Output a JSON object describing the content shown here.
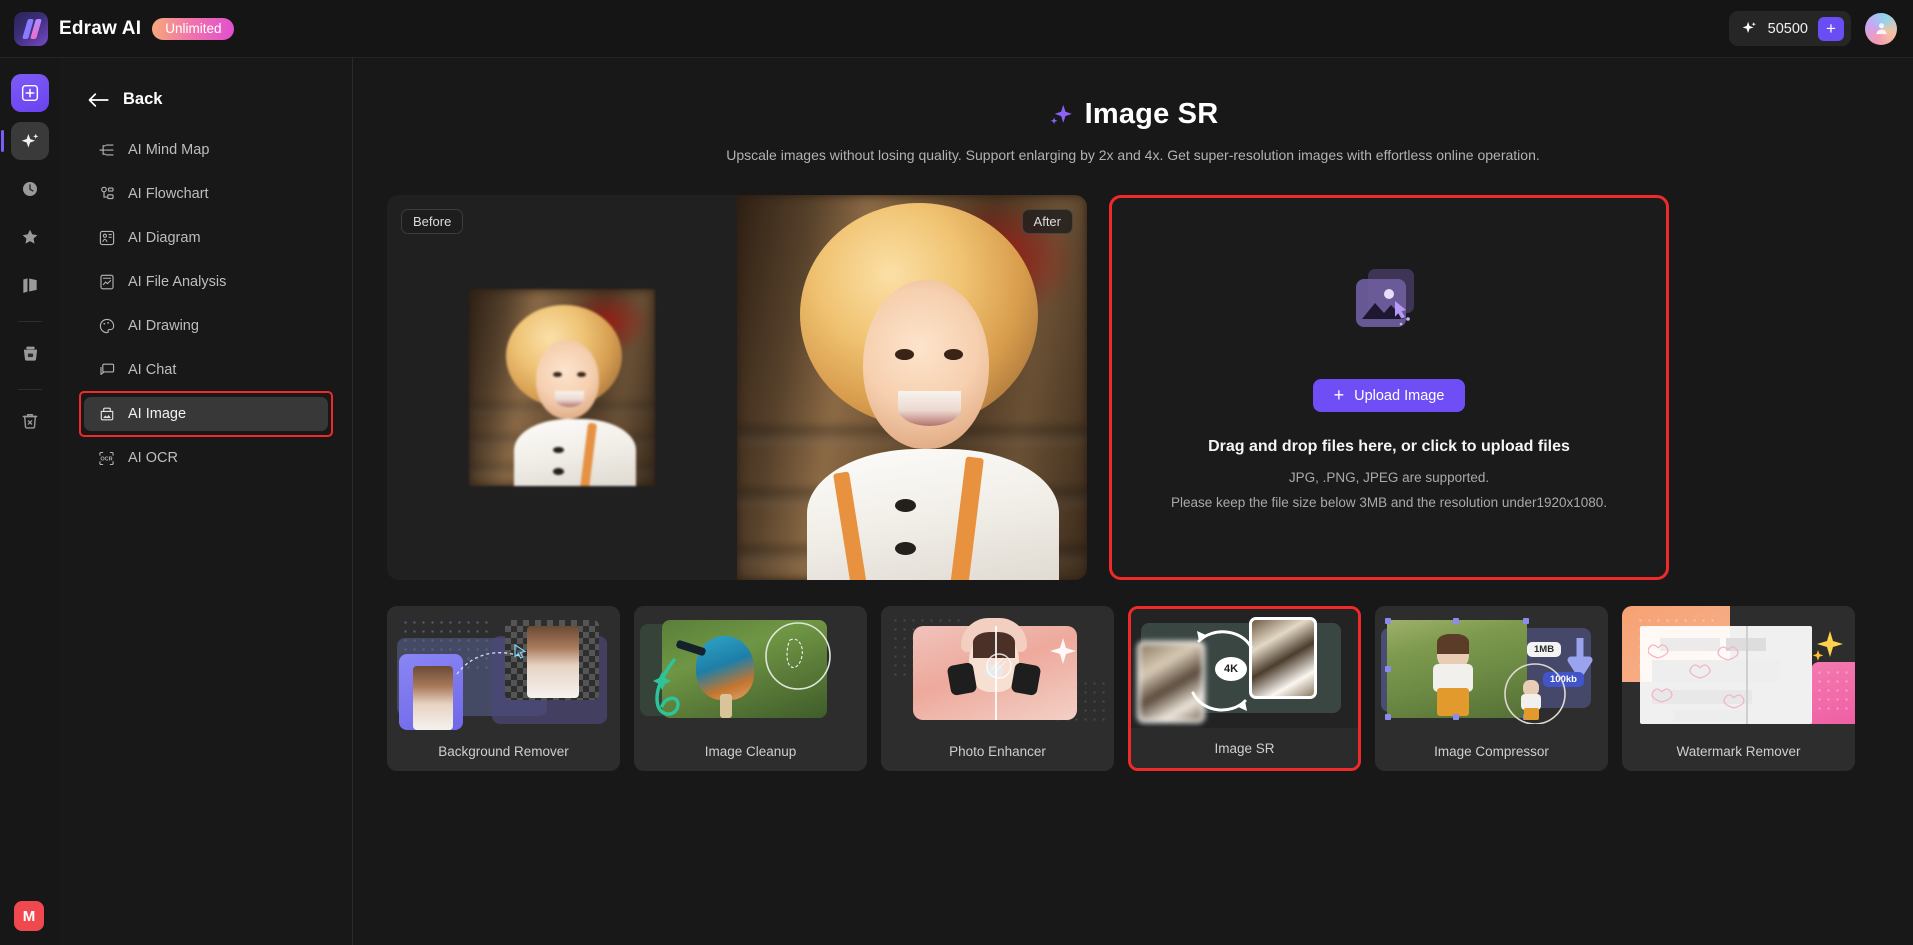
{
  "topbar": {
    "brand": "Edraw AI",
    "badge": "Unlimited",
    "credits": "50500",
    "add_credits_label": "+",
    "sparkle_icon": "sparkle-icon",
    "avatar_icon": "user-avatar-icon"
  },
  "rail": {
    "items": [
      {
        "name": "new-document",
        "icon": "plus-square-icon"
      },
      {
        "name": "ai-tools",
        "icon": "sparkle-icon",
        "active": true
      },
      {
        "name": "recent",
        "icon": "clock-icon"
      },
      {
        "name": "favorites",
        "icon": "star-icon"
      },
      {
        "name": "templates",
        "icon": "gallery-icon"
      },
      {
        "name": "files",
        "icon": "folder-icon"
      },
      {
        "name": "trash",
        "icon": "trash-icon"
      }
    ],
    "badge": "M"
  },
  "panel": {
    "back_label": "Back",
    "back_icon": "arrow-left-icon",
    "menu": [
      {
        "label": "AI Mind Map",
        "icon": "mind-map-icon",
        "selected": false
      },
      {
        "label": "AI Flowchart",
        "icon": "flowchart-icon",
        "selected": false
      },
      {
        "label": "AI Diagram",
        "icon": "diagram-icon",
        "selected": false
      },
      {
        "label": "AI File Analysis",
        "icon": "file-analysis-icon",
        "selected": false
      },
      {
        "label": "AI Drawing",
        "icon": "palette-icon",
        "selected": false
      },
      {
        "label": "AI Chat",
        "icon": "chat-bubble-icon",
        "selected": false
      },
      {
        "label": "AI Image",
        "icon": "image-icon",
        "selected": true
      },
      {
        "label": "AI OCR",
        "icon": "ocr-icon",
        "selected": false
      }
    ]
  },
  "main": {
    "title": "Image SR",
    "title_icon": "sparkle-icon",
    "subtitle": "Upscale images without losing quality. Support enlarging by 2x and 4x. Get super-resolution images with effortless online operation.",
    "preview": {
      "before_label": "Before",
      "after_label": "After"
    },
    "upload": {
      "icon": "image-upload-icon",
      "button_label": "Upload Image",
      "button_plus": "+",
      "headline": "Drag and drop files here, or click to upload files",
      "formats": "JPG, .PNG, JPEG are supported.",
      "limits": "Please keep the file size below 3MB and the resolution under1920x1080."
    },
    "cards": [
      {
        "label": "Background Remover",
        "selected": false
      },
      {
        "label": "Image Cleanup",
        "selected": false
      },
      {
        "label": "Photo Enhancer",
        "selected": false
      },
      {
        "label": "Image SR",
        "selected": true,
        "tag": "4K"
      },
      {
        "label": "Image Compressor",
        "selected": false,
        "tag_in": "1MB",
        "tag_out": "100kb"
      },
      {
        "label": "Watermark Remover",
        "selected": false
      }
    ]
  },
  "colors": {
    "accent_purple": "#6f4ef6",
    "highlight_red": "#ee2a2a",
    "bg": "#181818",
    "panel_bg": "#202020",
    "card_bg": "#262626"
  }
}
